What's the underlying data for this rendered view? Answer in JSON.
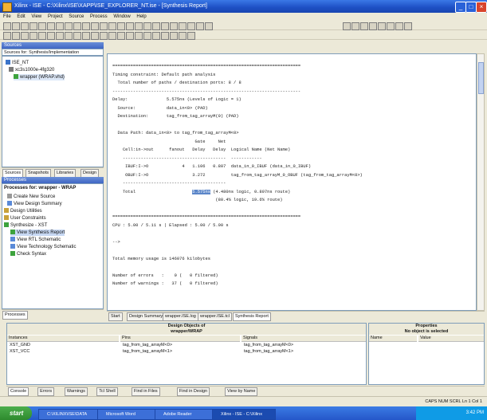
{
  "window": {
    "title": "Xilinx - ISE - C:\\Xilinx\\ISE\\XAPP\\ISE_EXPLORER_NT.ise - [Synthesis Report]"
  },
  "menu": [
    "File",
    "Edit",
    "View",
    "Project",
    "Source",
    "Process",
    "Window",
    "Help"
  ],
  "sources_panel": {
    "title": "Sources",
    "mode": "Sources for: Synthesis/Implementation",
    "tree": [
      "ISE_NT",
      "xc3s1000e-4fg320",
      "wrapper (WRAP.vhd)"
    ],
    "tabs": [
      "Sources",
      "Snapshots",
      "Libraries",
      "Design"
    ]
  },
  "processes_panel": {
    "title": "Processes",
    "header": "Processes for: wrapper - WRAP",
    "items": [
      "Create New Source",
      "View Design Summary",
      "Design Utilities",
      "User Constraints",
      "Synthesize - XST",
      "View Synthesis Report",
      "View RTL Schematic",
      "View Technology Schematic",
      "Check Syntax"
    ],
    "tab": "Processes"
  },
  "report": {
    "lines": [
      "=========================================================================",
      "Timing constraint: Default path analysis",
      "  Total number of paths / destination ports: 8 / 8",
      "-------------------------------------------------------------------------",
      "Delay:               5.575ns (Levels of Logic = 1)",
      "  Source:            data_in<0> (PAD)",
      "  Destination:       tag_from_tag_arrayM(0) (PAD)",
      "",
      "  Data Path: data_in<0> to tag_from_tag_arrayM<0>",
      "                                Gate     Net",
      "    Cell:in->out      fanout   Delay   Delay  Logical Name (Net Name)",
      "    ----------------------------------------  ------------",
      "     IBUF:I->O             4   1.106   0.807  data_in_0_IBUF (data_in_0_IBUF)",
      "     OBUF:I->O                 3.272          tag_from_tag_arrayM_0_OBUF (tag_from_tag_arrayM<0>)",
      "    ----------------------------------------",
      "    Total                      5.575ns (4.480ns logic, 0.807ns route)",
      "                                        (80.4% logic, 19.6% route)",
      "",
      "=========================================================================",
      "CPU : 5.00 / 5.11 s | Elapsed : 5.00 / 5.00 s",
      "",
      "-->",
      "",
      "Total memory usage is 146076 kilobytes",
      "",
      "Number of errors   :    0 (   0 filtered)",
      "Number of warnings :   37 (   0 filtered)"
    ],
    "highlight": "5.575ns"
  },
  "report_tabs": [
    "Start",
    "Design Summary",
    "wrapper.ISE.log",
    "wrapper.ISE.tcl",
    "Synthesis Report"
  ],
  "bottom": {
    "design_objects_title": "Design Objects of",
    "design_objects_sub": "wrapper/WRAP",
    "cols": [
      "Instances",
      "Pins",
      "Signals"
    ],
    "instances": [
      "XST_GND",
      "XST_VCC"
    ],
    "pins": [
      "tag_from_tag_arrayM<0>",
      "tag_from_tag_arrayM<1>"
    ],
    "signals": [
      "tag_from_tag_arrayM<0>",
      "tag_from_tag_arrayM<1>"
    ],
    "properties_title": "Properties",
    "properties_sub": "No object is selected",
    "prop_cols": [
      "Name",
      "Value"
    ]
  },
  "bottom_tabs": [
    "Console",
    "Errors",
    "Warnings",
    "Tcl Shell",
    "Find in Files",
    "Find in Design",
    "View by Name"
  ],
  "status": "CAPS NUM SCRL Ln 1 Col 1",
  "taskbar": {
    "start": "start",
    "tasks": [
      "C:\\XILINX\\ISE\\DATA",
      "Microsoft Word",
      "Adobe Reader",
      "Xilinx - ISE - C:\\Xilinx"
    ],
    "clock": "3:42 PM"
  }
}
